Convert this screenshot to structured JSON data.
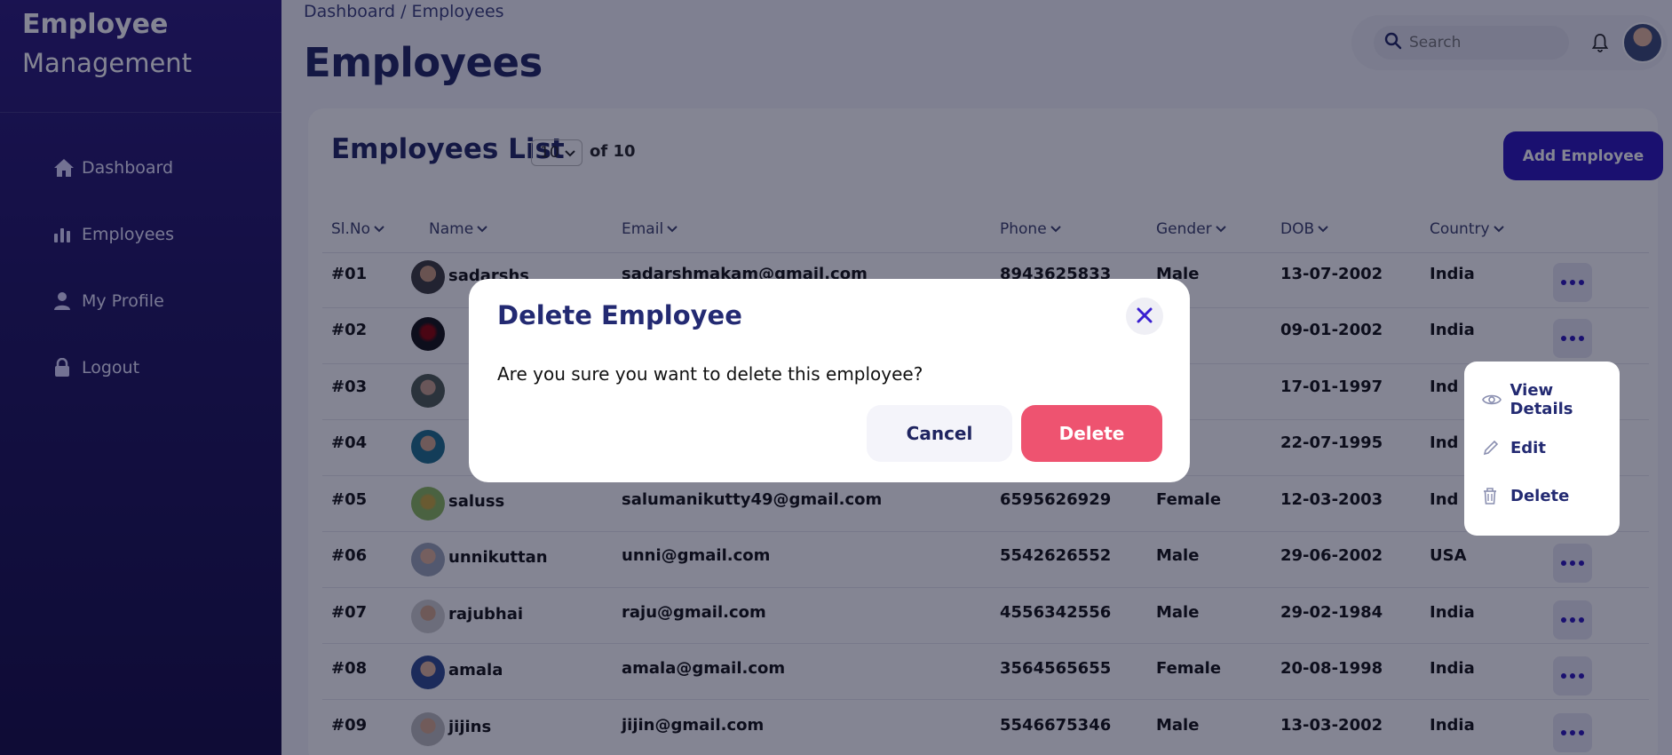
{
  "sidebar": {
    "brand_line1": "Employee",
    "brand_line2": "Management",
    "items": [
      {
        "label": "Dashboard",
        "icon": "home-icon"
      },
      {
        "label": "Employees",
        "icon": "bar-chart-icon"
      },
      {
        "label": "My Profile",
        "icon": "user-icon"
      },
      {
        "label": "Logout",
        "icon": "lock-icon"
      }
    ]
  },
  "header": {
    "breadcrumb": "Dashboard / Employees",
    "title": "Employees",
    "search_placeholder": "Search"
  },
  "list": {
    "title": "Employees List",
    "per_page": "10",
    "of_total": "of 10",
    "add_button": "Add Employee",
    "columns": [
      "Sl.No",
      "Name",
      "Email",
      "Phone",
      "Gender",
      "DOB",
      "Country"
    ],
    "rows": [
      {
        "id": "#01",
        "name": "sadarshs",
        "email": "sadarshmakam@gmail.com",
        "phone": "8943625833",
        "gender": "Male",
        "dob": "13-07-2002",
        "country": "India"
      },
      {
        "id": "#02",
        "name": "",
        "email": "",
        "phone": "",
        "gender": "le",
        "dob": "09-01-2002",
        "country": "India"
      },
      {
        "id": "#03",
        "name": "",
        "email": "",
        "phone": "",
        "gender": "le",
        "dob": "17-01-1997",
        "country": "Ind"
      },
      {
        "id": "#04",
        "name": "",
        "email": "",
        "phone": "",
        "gender": "le",
        "dob": "22-07-1995",
        "country": "Ind"
      },
      {
        "id": "#05",
        "name": "saluss",
        "email": "salumanikutty49@gmail.com",
        "phone": "6595626929",
        "gender": "Female",
        "dob": "12-03-2003",
        "country": "Ind"
      },
      {
        "id": "#06",
        "name": "unnikuttan",
        "email": "unni@gmail.com",
        "phone": "5542626552",
        "gender": "Male",
        "dob": "29-06-2002",
        "country": "USA"
      },
      {
        "id": "#07",
        "name": "rajubhai",
        "email": "raju@gmail.com",
        "phone": "4556342556",
        "gender": "Male",
        "dob": "29-02-1984",
        "country": "India"
      },
      {
        "id": "#08",
        "name": "amala",
        "email": "amala@gmail.com",
        "phone": "3564565655",
        "gender": "Female",
        "dob": "20-08-1998",
        "country": "India"
      },
      {
        "id": "#09",
        "name": "jijins",
        "email": "jijin@gmail.com",
        "phone": "5546675346",
        "gender": "Male",
        "dob": "13-03-2002",
        "country": "India"
      }
    ]
  },
  "action_menu": {
    "view": "View Details",
    "edit": "Edit",
    "delete": "Delete"
  },
  "modal": {
    "title": "Delete Employee",
    "message": "Are you sure you want to delete this employee?",
    "cancel": "Cancel",
    "confirm": "Delete"
  },
  "colors": {
    "accent": "#2a14b8",
    "danger": "#ee5370",
    "title": "#1f2460"
  }
}
